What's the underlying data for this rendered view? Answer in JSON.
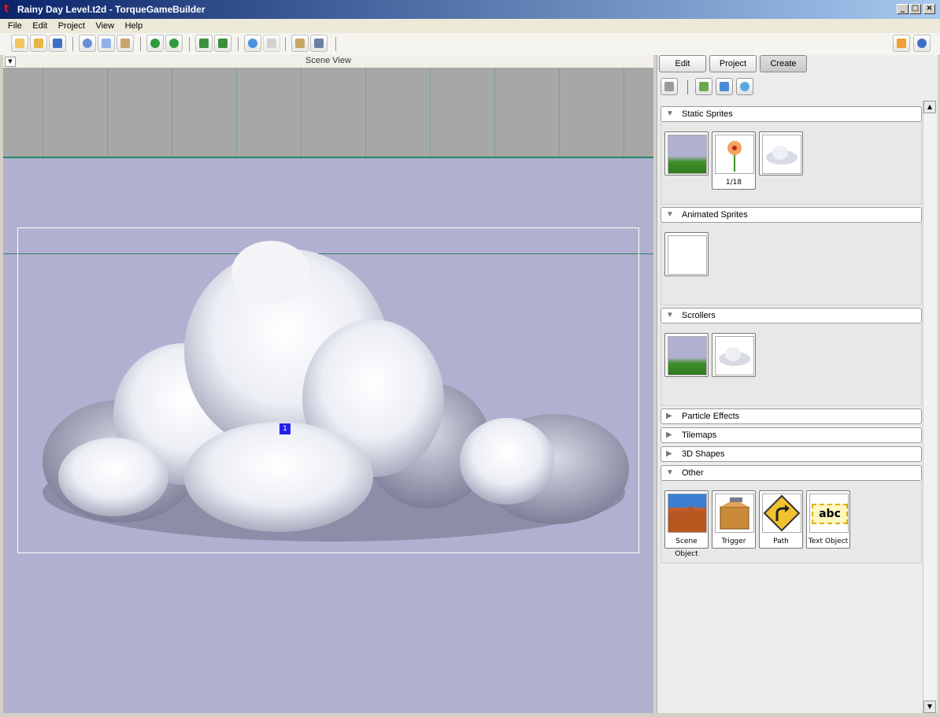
{
  "window": {
    "title": "Rainy Day Level.t2d - TorqueGameBuilder",
    "controls": [
      "minimize",
      "maximize",
      "close"
    ]
  },
  "menu": {
    "items": [
      "File",
      "Edit",
      "Project",
      "View",
      "Help"
    ]
  },
  "toolbar": {
    "buttons": [
      "new-icon",
      "open-icon",
      "save-icon",
      "cut-icon",
      "copy-icon",
      "paste-icon",
      "undo-icon",
      "redo-icon",
      "layer-back-icon",
      "layer-front-icon",
      "play-icon",
      "select-icon",
      "edit-script-icon",
      "deploy-icon"
    ],
    "right_buttons": [
      "tutorial-icon",
      "info-icon"
    ]
  },
  "scene": {
    "header": "Scene View",
    "object_marker": "1"
  },
  "panel": {
    "tabs": [
      "Edit",
      "Project",
      "Create"
    ],
    "active_tab": "Create",
    "sections": {
      "static_sprites": {
        "label": "Static Sprites",
        "expanded": true,
        "frame_label": "1/18"
      },
      "animated_sprites": {
        "label": "Animated Sprites",
        "expanded": true
      },
      "scrollers": {
        "label": "Scrollers",
        "expanded": true
      },
      "particle_effects": {
        "label": "Particle Effects",
        "expanded": false
      },
      "tilemaps": {
        "label": "Tilemaps",
        "expanded": false
      },
      "shapes_3d": {
        "label": "3D Shapes",
        "expanded": false
      },
      "other": {
        "label": "Other",
        "expanded": true,
        "items": [
          "Scene Object",
          "Trigger",
          "Path",
          "Text Object"
        ],
        "text_object_preview": "abc"
      }
    },
    "colors": {
      "scene_bg": "#b2b0d0",
      "scene_top": "#a7a7a7",
      "grass": "#3f8f2a",
      "marker": "#2222ee"
    }
  }
}
